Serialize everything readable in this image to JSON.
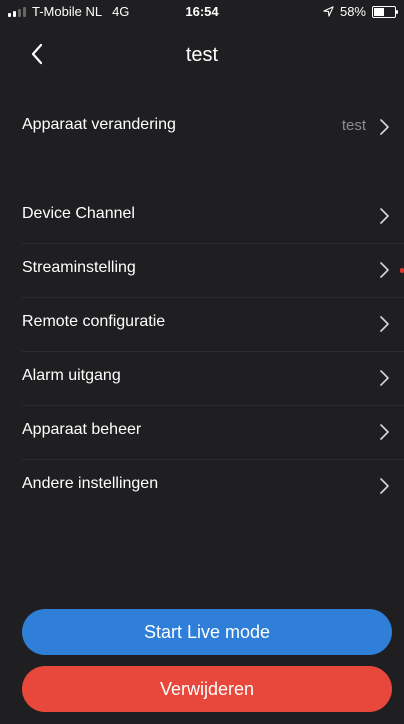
{
  "status": {
    "carrier": "T-Mobile NL",
    "network": "4G",
    "time": "16:54",
    "battery": "58%",
    "battery_level": 0.58,
    "location_icon": "location-arrow-icon"
  },
  "nav": {
    "title": "test",
    "back_icon": "chevron-left-icon"
  },
  "device_row": {
    "label": "Apparaat verandering",
    "value": "test"
  },
  "menu": [
    {
      "label": "Device Channel"
    },
    {
      "label": "Streaminstelling"
    },
    {
      "label": "Remote configuratie"
    },
    {
      "label": "Alarm uitgang"
    },
    {
      "label": "Apparaat beheer"
    },
    {
      "label": "Andere instellingen"
    }
  ],
  "buttons": {
    "live": "Start Live mode",
    "delete": "Verwijderen"
  },
  "colors": {
    "background": "#1f1f21",
    "live_button": "#2f7ed8",
    "delete_button": "#e8483b",
    "secondary_text": "#8c8c8c"
  }
}
